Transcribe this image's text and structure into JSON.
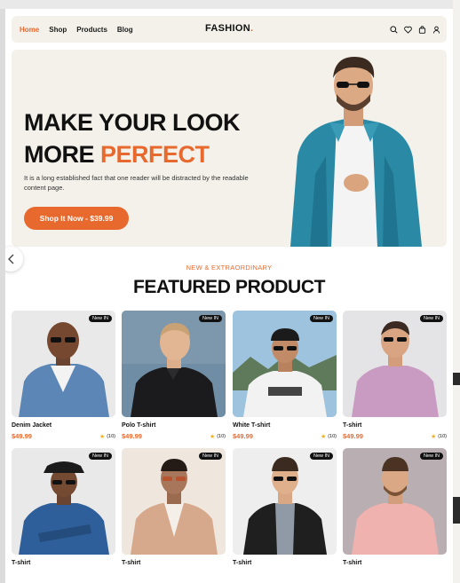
{
  "nav": {
    "links": [
      "Home",
      "Shop",
      "Products",
      "Blog"
    ],
    "active": "Home",
    "logo": "FASHION",
    "logo_dot": ".",
    "icons": [
      "search-icon",
      "heart-icon",
      "bag-icon",
      "user-icon"
    ]
  },
  "hero": {
    "title_line1": "MAKE YOUR LOOK",
    "title_line2_plain": "MORE ",
    "title_line2_accent": "PERFECT",
    "description": "It is a long established fact that one reader will be distracted by the readable content page.",
    "cta": "Shop It Now - $39.99"
  },
  "featured": {
    "eyebrow": "NEW & EXTRAORDINARY",
    "title": "FEATURED PRODUCT",
    "badge": "New IN",
    "products": [
      {
        "name": "Denim Jacket",
        "price": "$49.99",
        "rating": "(10)"
      },
      {
        "name": "Polo T-shirt",
        "price": "$49.99",
        "rating": "(10)"
      },
      {
        "name": "White T-shirt",
        "price": "$49.99",
        "rating": "(10)"
      },
      {
        "name": "T-shirt",
        "price": "$49.99",
        "rating": "(10)"
      },
      {
        "name": "T-shirt",
        "price": "",
        "rating": ""
      },
      {
        "name": "T-shirt",
        "price": "",
        "rating": ""
      },
      {
        "name": "T-shirt",
        "price": "",
        "rating": ""
      },
      {
        "name": "T-shirt",
        "price": "",
        "rating": ""
      }
    ]
  },
  "colors": {
    "accent": "#e8692d",
    "hero_bg": "#f3f1ea",
    "star": "#f2b01e"
  }
}
